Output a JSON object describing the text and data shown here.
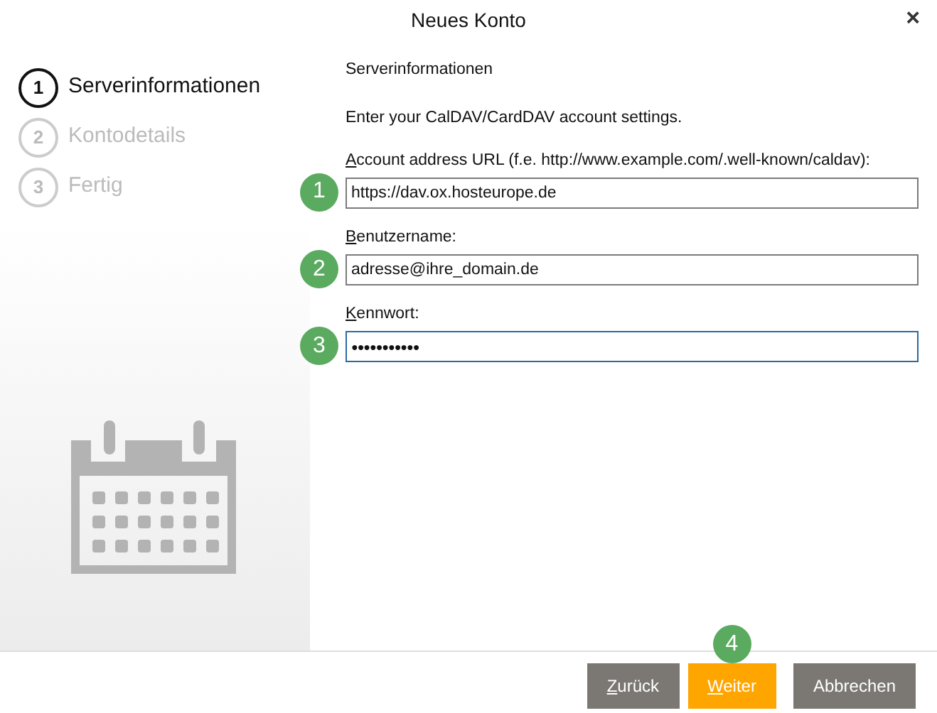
{
  "window": {
    "title": "Neues Konto",
    "close": "×"
  },
  "steps": [
    {
      "number": "1",
      "label": "Serverinformationen",
      "selected": true
    },
    {
      "number": "2",
      "label": "Kontodetails",
      "selected": false
    },
    {
      "number": "3",
      "label": "Fertig",
      "selected": false
    }
  ],
  "heading": "Serverinformationen",
  "intro": "Enter your CalDAV/CardDAV account settings.",
  "fields": [
    {
      "marker": "1",
      "label": "Account address URL (f.e. http://www.example.com/.well-known/caldav):",
      "mnemonic": true,
      "value": "https://dav.ox.hosteurope.de",
      "focused": false,
      "masked": false
    },
    {
      "marker": "2",
      "label": "Benutzername:",
      "mnemonic": true,
      "value": "adresse@ihre_domain.de",
      "focused": false,
      "masked": false
    },
    {
      "marker": "3",
      "label": "Kennwort:",
      "mnemonic": true,
      "value": "●●●●●●●●●●●",
      "focused": true,
      "masked": true
    }
  ],
  "buttons": [
    {
      "label": "Zurück",
      "kind": "secondary",
      "mnemonic": true
    },
    {
      "label": "Weiter",
      "kind": "primary",
      "mnemonic": true,
      "marker": "4"
    },
    {
      "label": "Abbrechen",
      "kind": "secondary",
      "mnemonic": false
    }
  ]
}
